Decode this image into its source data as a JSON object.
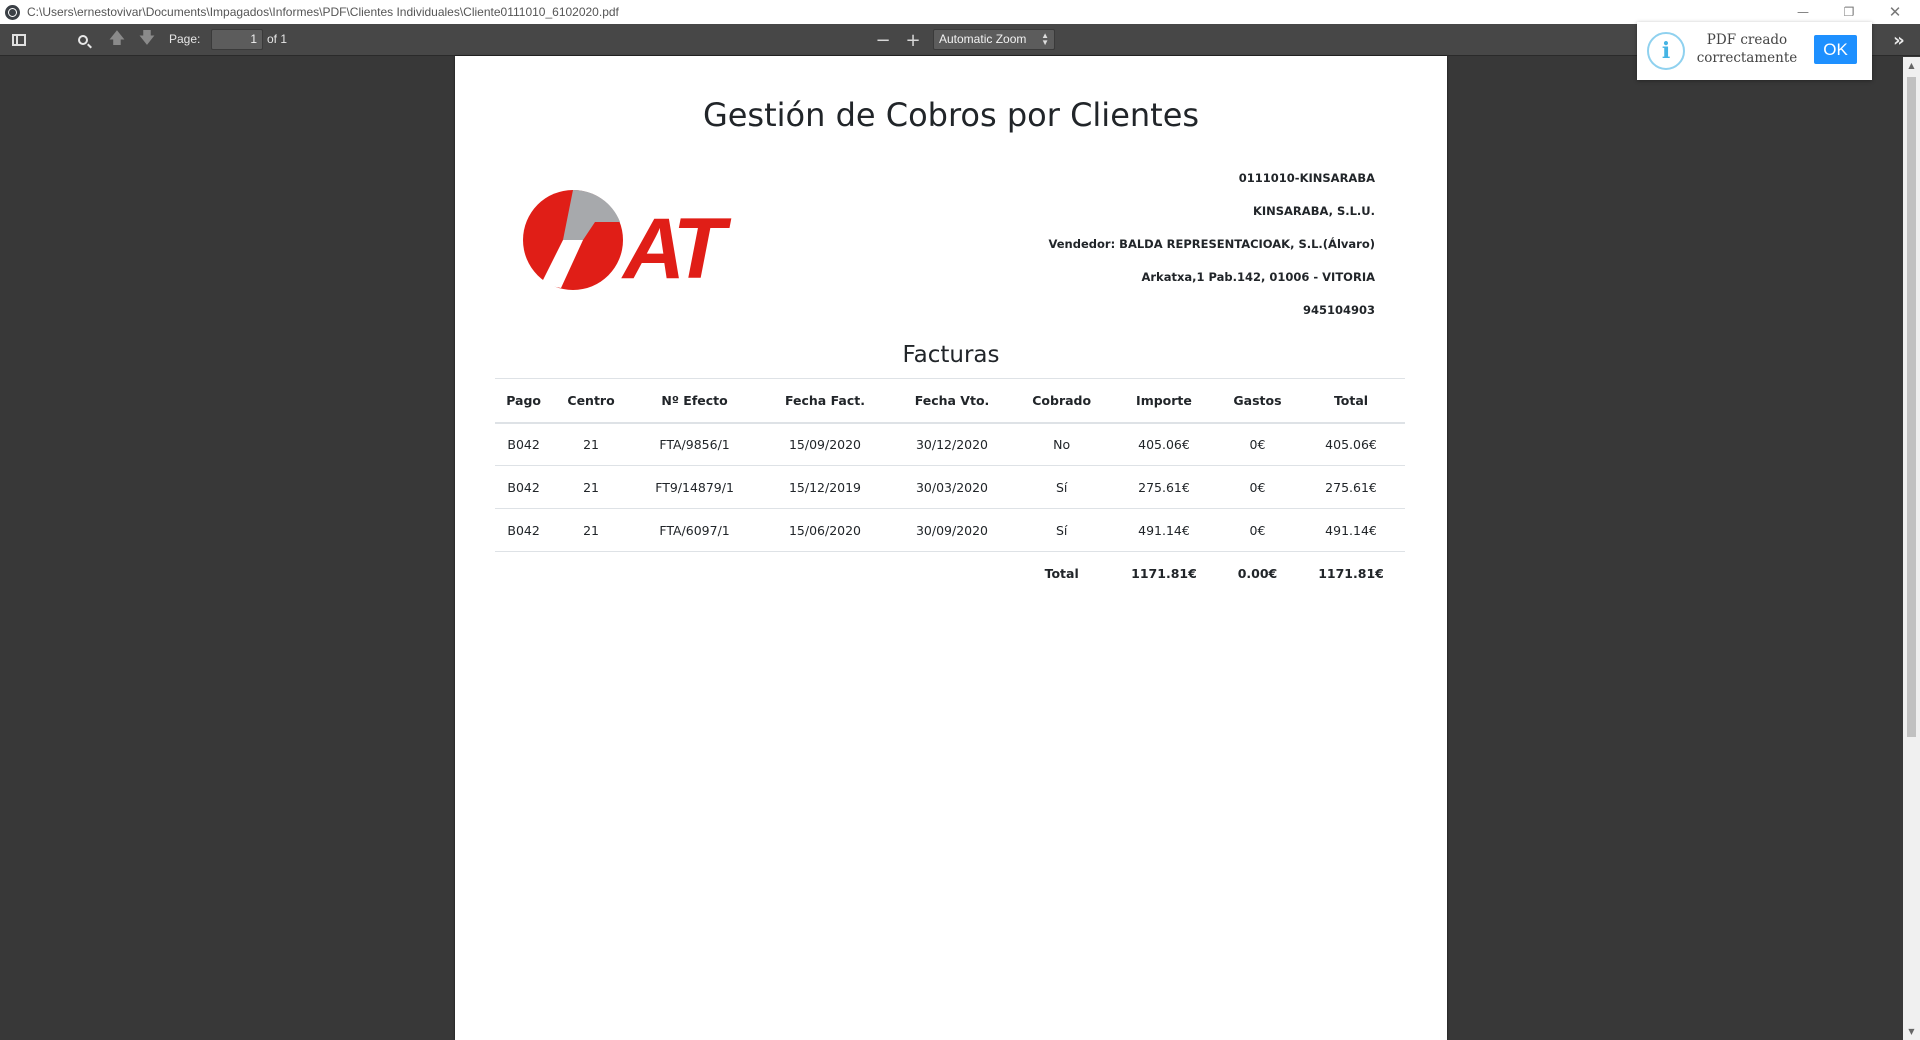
{
  "window": {
    "title": "C:\\Users\\ernestovivar\\Documents\\Impagados\\Informes\\PDF\\Clientes Individuales\\Cliente0111010_6102020.pdf",
    "minimize_icon": "—",
    "maximize_icon": "❐",
    "close_icon": "✕"
  },
  "toolbar": {
    "page_label": "Page:",
    "page_number": "1",
    "page_total": "of 1",
    "zoom_out": "−",
    "zoom_in": "+",
    "zoom_value": "Automatic Zoom",
    "tools_icon": "»",
    "prev_icon": "🡅",
    "next_icon": "🡇"
  },
  "document": {
    "title": "Gestión de Cobros por Clientes",
    "client": {
      "code": "0111010-KINSARABA",
      "name": "KINSARABA, S.L.U.",
      "seller": "Vendedor: BALDA REPRESENTACIOAK, S.L.(Álvaro)",
      "address": "Arkatxa,1 Pab.142, 01006 - VITORIA",
      "phone": "945104903"
    },
    "logo_text": "AT",
    "logo_colors": {
      "red": "#e01e17",
      "gray": "#a7a9ac"
    },
    "section_title": "Facturas",
    "table": {
      "headers": [
        "Pago",
        "Centro",
        "Nº Efecto",
        "Fecha Fact.",
        "Fecha Vto.",
        "Cobrado",
        "Importe",
        "Gastos",
        "Total"
      ],
      "rows": [
        [
          "B042",
          "21",
          "FTA/9856/1",
          "15/09/2020",
          "30/12/2020",
          "No",
          "405.06€",
          "0€",
          "405.06€"
        ],
        [
          "B042",
          "21",
          "FT9/14879/1",
          "15/12/2019",
          "30/03/2020",
          "Sí",
          "275.61€",
          "0€",
          "275.61€"
        ],
        [
          "B042",
          "21",
          "FTA/6097/1",
          "15/06/2020",
          "30/09/2020",
          "Sí",
          "491.14€",
          "0€",
          "491.14€"
        ]
      ],
      "total_label": "Total",
      "total_importe": "1171.81€",
      "total_gastos": "0.00€",
      "total_total": "1171.81€"
    }
  },
  "notification": {
    "icon": "i",
    "line1": "PDF creado",
    "line2": "correctamente",
    "ok_label": "OK"
  }
}
